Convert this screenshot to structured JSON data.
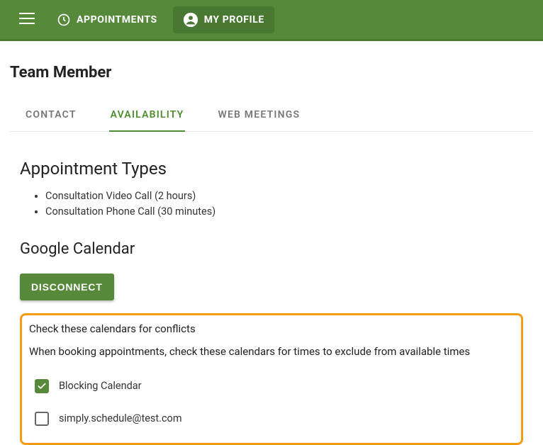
{
  "colors": {
    "primary": "#568a3a",
    "accent": "#f39c12"
  },
  "topbar": {
    "nav": [
      {
        "label": "APPOINTMENTS",
        "icon": "clock-icon",
        "active": false
      },
      {
        "label": "MY PROFILE",
        "icon": "person-circle-icon",
        "active": true
      }
    ]
  },
  "page_title": "Team Member",
  "tabs": [
    {
      "label": "CONTACT",
      "active": false
    },
    {
      "label": "AVAILABILITY",
      "active": true
    },
    {
      "label": "WEB MEETINGS",
      "active": false
    }
  ],
  "appointment_types": {
    "heading": "Appointment Types",
    "items": [
      "Consultation Video Call (2 hours)",
      "Consultation Phone Call (30 minutes)"
    ]
  },
  "google_calendar": {
    "heading": "Google Calendar",
    "disconnect_label": "DISCONNECT",
    "conflicts": {
      "title": "Check these calendars for conflicts",
      "description": "When booking appointments, check these calendars for times to exclude from available times",
      "calendars": [
        {
          "label": "Blocking Calendar",
          "checked": true
        },
        {
          "label": "simply.schedule@test.com",
          "checked": false
        }
      ]
    }
  }
}
